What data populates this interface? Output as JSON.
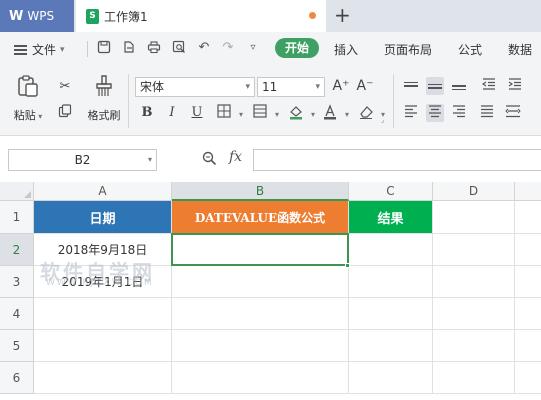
{
  "titlebar": {
    "app_tab": "WPS",
    "doc_tab": "工作簿1",
    "doc_icon_letter": "S",
    "add_tab": "+"
  },
  "menubar": {
    "file_label": "文件",
    "start_label": "开始",
    "tabs": [
      "插入",
      "页面布局",
      "公式",
      "数据"
    ],
    "quick_icons": [
      "save-icon",
      "export-icon",
      "print-icon",
      "preview-icon",
      "undo-icon",
      "redo-icon",
      "more-icon"
    ]
  },
  "ribbon": {
    "paste_label": "粘贴",
    "format_painter_label": "格式刷",
    "font_name": "宋体",
    "font_size": "11",
    "font_grow": "A⁺",
    "font_shrink": "A⁻"
  },
  "formula_bar": {
    "name_box": "B2",
    "fx_label": "fx",
    "formula_value": ""
  },
  "grid": {
    "columns": [
      "A",
      "B",
      "C",
      "D"
    ],
    "rows": [
      "1",
      "2",
      "3",
      "4",
      "5",
      "6"
    ],
    "selected_cell": "B2",
    "header_row": {
      "a": "日期",
      "b": "DATEVALUE函数公式",
      "c": "结果"
    },
    "cells": {
      "a2": "2018年9月18日",
      "a3": "2019年1月1日"
    },
    "colors": {
      "header_a": "#2e75b6",
      "header_b": "#ed7d31",
      "header_c": "#00b050",
      "selection": "#3b9552"
    }
  },
  "watermark": {
    "text": "软件自学网",
    "sub": "WWW.RJZXW.COM"
  }
}
